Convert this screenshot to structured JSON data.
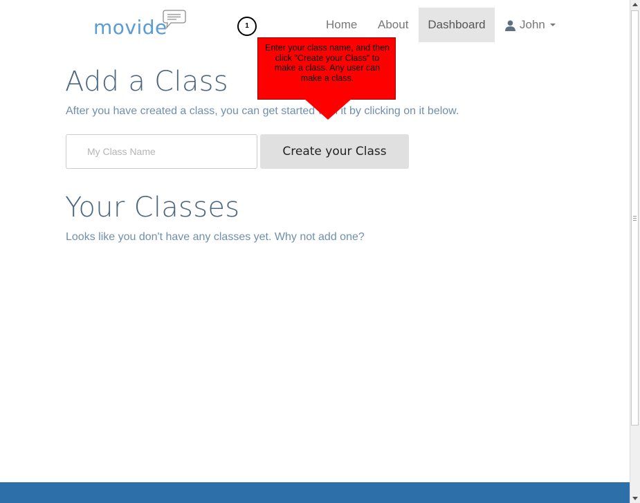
{
  "brand": {
    "name": "movide"
  },
  "nav": {
    "home": "Home",
    "about": "About",
    "dashboard": "Dashboard",
    "user": "John"
  },
  "callout": {
    "step": "1",
    "text": "Enter your class name, and then click \"Create your Class\" to make a class. Any user can make a class."
  },
  "add_class": {
    "title": "Add a Class",
    "description": "After you have created a class, you can get started with it by clicking on it below.",
    "input_placeholder": "My Class Name",
    "input_value": "",
    "button_label": "Create your Class"
  },
  "your_classes": {
    "title": "Your Classes",
    "empty_message": "Looks like you don't have any classes yet. Why not add one?"
  },
  "colors": {
    "brand": "#5b9bd5",
    "heading": "#4d6680",
    "callout": "#ff0000",
    "footer": "#2d6fa9"
  },
  "icons": {
    "logo_bubble": "speech-bubble-icon",
    "user": "user-icon",
    "caret": "caret-down-icon"
  }
}
